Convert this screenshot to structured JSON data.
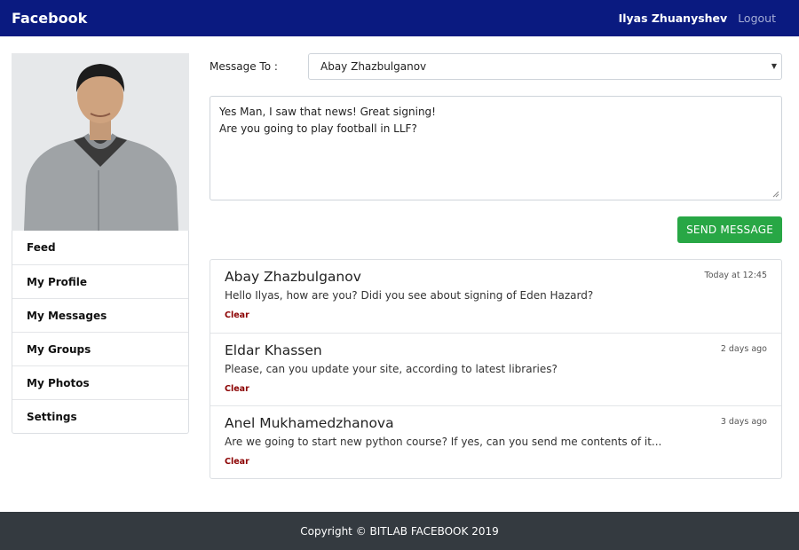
{
  "navbar": {
    "brand": "Facebook",
    "user_name": "Ilyas Zhuanyshev",
    "logout_label": "Logout"
  },
  "sidebar": {
    "items": [
      {
        "label": "Feed"
      },
      {
        "label": "My Profile"
      },
      {
        "label": "My Messages"
      },
      {
        "label": "My Groups"
      },
      {
        "label": "My Photos"
      },
      {
        "label": "Settings"
      }
    ]
  },
  "compose": {
    "to_label": "Message To :",
    "recipient": "Abay Zhazbulganov",
    "body_line1": "Yes Man, I saw that news! Great signing!",
    "body_line2": "Are you going to play football in LLF?",
    "send_label": "SEND MESSAGE"
  },
  "messages": [
    {
      "name": "Abay Zhazbulganov",
      "time": "Today at 12:45",
      "text": "Hello Ilyas, how are you? Didi you see about signing of Eden Hazard?",
      "clear": "Clear"
    },
    {
      "name": "Eldar Khassen",
      "time": "2 days ago",
      "text": "Please, can you update your site, according to latest libraries?",
      "clear": "Clear"
    },
    {
      "name": "Anel Mukhamedzhanova",
      "time": "3 days ago",
      "text": "Are we going to start new python course? If yes, can you send me contents of it...",
      "clear": "Clear"
    }
  ],
  "footer": {
    "copyright": "Copyright © BITLAB FACEBOOK 2019"
  },
  "colors": {
    "navbar": "#0a1a80",
    "send_button": "#28a745",
    "clear_link": "#8b0000",
    "footer": "#343a40"
  }
}
